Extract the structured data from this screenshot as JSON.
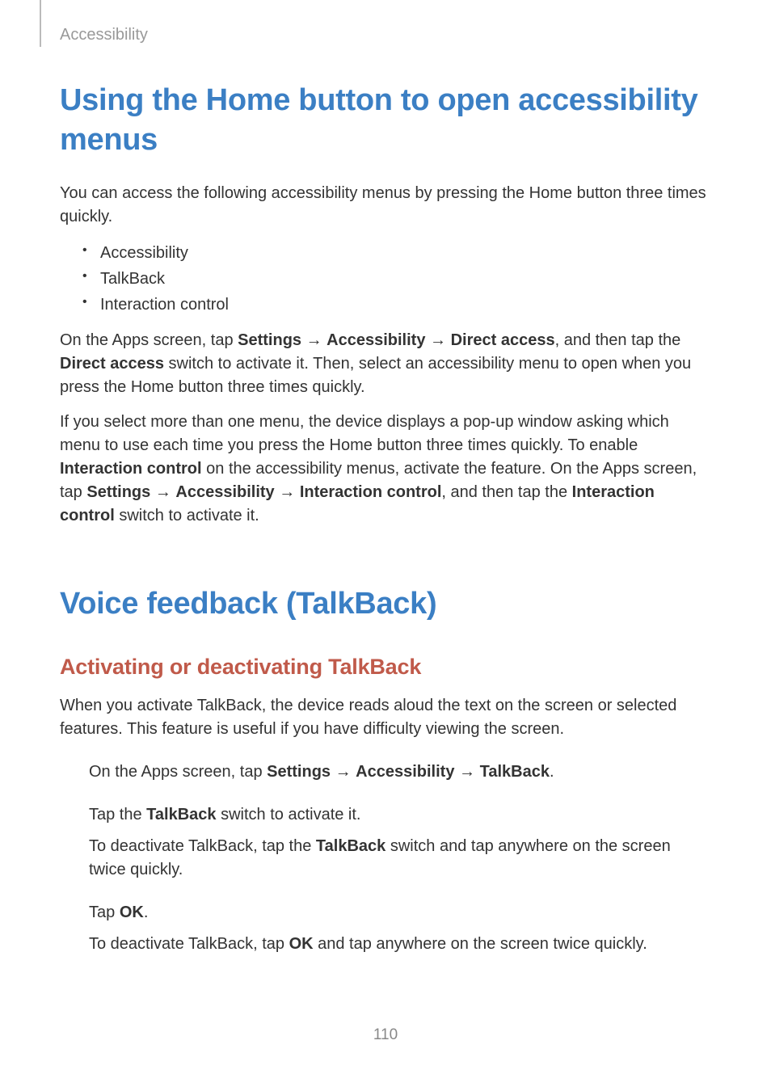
{
  "header": {
    "section": "Accessibility"
  },
  "h1_a": "Using the Home button to open accessibility menus",
  "p_intro": "You can access the following accessibility menus by pressing the Home button three times quickly.",
  "bullets": {
    "b1": "Accessibility",
    "b2": "TalkBack",
    "b3": "Interaction control"
  },
  "p_direct": {
    "t1": "On the Apps screen, tap ",
    "s1": "Settings",
    "a1": " → ",
    "s2": "Accessibility",
    "a2": " → ",
    "s3": "Direct access",
    "t2": ", and then tap the ",
    "s4": "Direct access",
    "t3": " switch to activate it. Then, select an accessibility menu to open when you press the Home button three times quickly."
  },
  "p_multi": {
    "t1": "If you select more than one menu, the device displays a pop-up window asking which menu to use each time you press the Home button three times quickly. To enable ",
    "s1": "Interaction control",
    "t2": " on the accessibility menus, activate the feature. On the Apps screen, tap ",
    "s2": "Settings",
    "a1": " → ",
    "s3": "Accessibility",
    "a2": " → ",
    "s4": "Interaction control",
    "t3": ", and then tap the ",
    "s5": "Interaction control",
    "t4": " switch to activate it."
  },
  "h1_b": "Voice feedback (TalkBack)",
  "h2_a": "Activating or deactivating TalkBack",
  "p_activate": "When you activate TalkBack, the device reads aloud the text on the screen or selected features. This feature is useful if you have difficulty viewing the screen.",
  "step1": {
    "t1": "On the Apps screen, tap ",
    "s1": "Settings",
    "a1": " → ",
    "s2": "Accessibility",
    "a2": " → ",
    "s3": "TalkBack",
    "t2": "."
  },
  "step2a": {
    "t1": "Tap the ",
    "s1": "TalkBack",
    "t2": " switch to activate it."
  },
  "step2b": {
    "t1": "To deactivate TalkBack, tap the ",
    "s1": "TalkBack",
    "t2": " switch and tap anywhere on the screen twice quickly."
  },
  "step3a": {
    "t1": "Tap ",
    "s1": "OK",
    "t2": "."
  },
  "step3b": {
    "t1": "To deactivate TalkBack, tap ",
    "s1": "OK",
    "t2": " and tap anywhere on the screen twice quickly."
  },
  "page_number": "110"
}
